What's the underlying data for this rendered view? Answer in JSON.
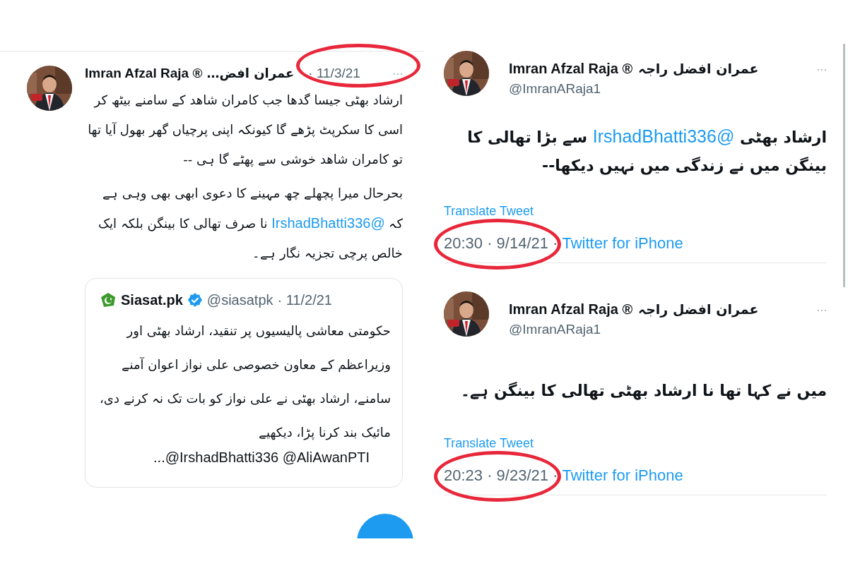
{
  "left_panel": {
    "tweet": {
      "name": "Imran Afzal Raja ®",
      "name_urdu": "عمران افض…",
      "date": "· 11/3/21",
      "more": "···",
      "paragraphs": [
        [
          {
            "kind": "text",
            "text": "ارشاد بھٹی جیسا گدھا جب کامران شاھد کے سامنے بیٹھ کر اسی کا سکرپٹ پڑھے گا کیونکہ اپنی پرچیاں گھر بھول آیا تھا تو کامران شاھد خوشی سے پھٹے گا ہی --"
          }
        ],
        [
          {
            "kind": "text",
            "text": "بحرحال میرا پچھلے چھ مہینے کا دعوی ابھی بھی وہی ہے کہ "
          },
          {
            "kind": "mention",
            "text": "@IrshadBhatti336"
          },
          {
            "kind": "text",
            "text": " نا صرف تھالی کا بینگن بلکہ ایک خالص پرچی تجزیہ نگار ہے۔"
          }
        ]
      ],
      "quoted_tweet": {
        "name": "Siasat.pk",
        "verified": true,
        "handle": "@siasatpk",
        "date": "· 11/2/21",
        "text": "حکومتی معاشی پالیسیوں پر تنقید، ارشاد بھٹی اور وزیراعظم کے معاون خصوصی علی نواز اعوان آمنے سامنے، ارشاد بھٹی نے علی نواز کو بات تک نہ کرنے دی، مائیک بند کرنا پڑا، دیکھیے",
        "mentions": "...@IrshadBhatti336 @AliAwanPTI"
      }
    }
  },
  "right_panel": {
    "tweets": [
      {
        "name": "Imran Afzal Raja ®",
        "name_urdu": "عمران افضل راجہ",
        "handle": "@ImranARaja1",
        "more": "···",
        "paragraphs": [
          [
            {
              "kind": "text",
              "text": "ارشاد بھٹی "
            },
            {
              "kind": "mention",
              "text": "@IrshadBhatti336"
            },
            {
              "kind": "text",
              "text": " سے بڑا تھالی کا بینگن میں نے زندگی میں نہیں دیکھا--"
            }
          ]
        ],
        "translate": "Translate Tweet",
        "time": "20:30 · 9/14/21 ·",
        "source": "Twitter for iPhone"
      },
      {
        "name": "Imran Afzal Raja ®",
        "name_urdu": "عمران افضل راجہ",
        "handle": "@ImranARaja1",
        "more": "···",
        "paragraphs": [
          [
            {
              "kind": "text",
              "text": "میں نے کہا تھا نا ارشاد بھٹی تھالی کا بینگن ہے۔"
            }
          ]
        ],
        "translate": "Translate Tweet",
        "time": "20:23 · 9/23/21 ·",
        "source": "Twitter for iPhone"
      }
    ]
  }
}
